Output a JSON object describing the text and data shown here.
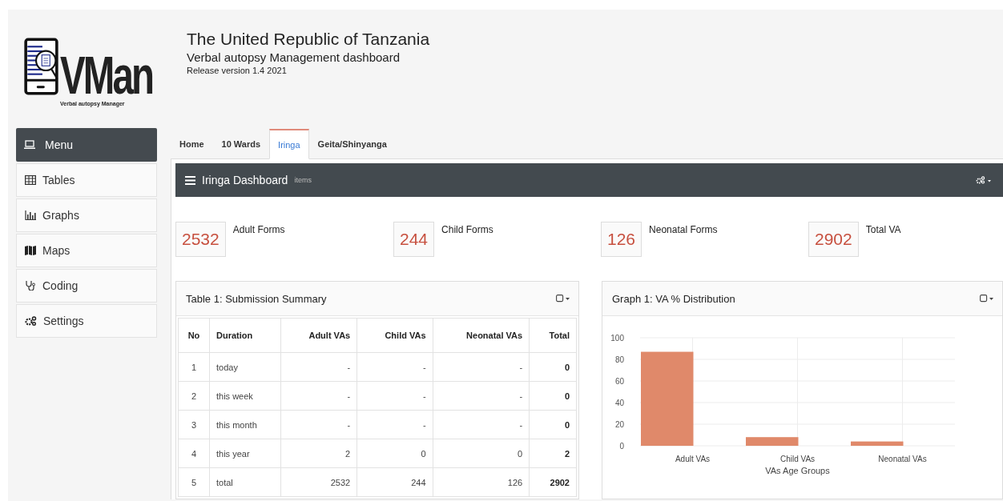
{
  "logo": {
    "wordmark": "VMan",
    "tagline": "Verbal autopsy Manager"
  },
  "header": {
    "title": "The United Republic of Tanzania",
    "subtitle": "Verbal autopsy Management dashboard",
    "release": "Release version 1.4 2021"
  },
  "sidebar": {
    "header": "Menu",
    "items": [
      {
        "label": "Tables",
        "kind": "table"
      },
      {
        "label": "Graphs",
        "kind": "chart"
      },
      {
        "label": "Maps",
        "kind": "map"
      },
      {
        "label": "Coding",
        "kind": "stethoscope"
      },
      {
        "label": "Settings",
        "kind": "gears"
      }
    ]
  },
  "tabs": [
    {
      "label": "Home",
      "selected": false
    },
    {
      "label": "10 Wards",
      "selected": false
    },
    {
      "label": "Iringa",
      "selected": true
    },
    {
      "label": "Geita/Shinyanga",
      "selected": false
    }
  ],
  "dashboard": {
    "title": "Iringa Dashboard",
    "subtitle": "items"
  },
  "stats": [
    {
      "value": "2532",
      "label": "Adult Forms"
    },
    {
      "value": "244",
      "label": "Child Forms"
    },
    {
      "value": "126",
      "label": "Neonatal Forms"
    },
    {
      "value": "2902",
      "label": "Total VA"
    }
  ],
  "table_panel": {
    "title": "Table 1: Submission Summary",
    "columns": [
      "No",
      "Duration",
      "Adult VAs",
      "Child VAs",
      "Neonatal VAs",
      "Total"
    ],
    "rows": [
      [
        "1",
        "today",
        "-",
        "-",
        "-",
        "0"
      ],
      [
        "2",
        "this week",
        "-",
        "-",
        "-",
        "0"
      ],
      [
        "3",
        "this month",
        "-",
        "-",
        "-",
        "0"
      ],
      [
        "4",
        "this year",
        "2",
        "0",
        "0",
        "2"
      ],
      [
        "5",
        "total",
        "2532",
        "244",
        "126",
        "2902"
      ]
    ]
  },
  "graph_panel": {
    "title": "Graph 1: VA % Distribution",
    "chart_data": {
      "type": "bar",
      "xlabel": "VAs Age Groups",
      "categories": [
        "Adult VAs",
        "Child VAs",
        "Neonatal VAs"
      ],
      "values": [
        87,
        8,
        4
      ],
      "ylim": [
        0,
        100
      ],
      "yticks": [
        0,
        20,
        40,
        60,
        80,
        100
      ],
      "grid": true
    }
  }
}
